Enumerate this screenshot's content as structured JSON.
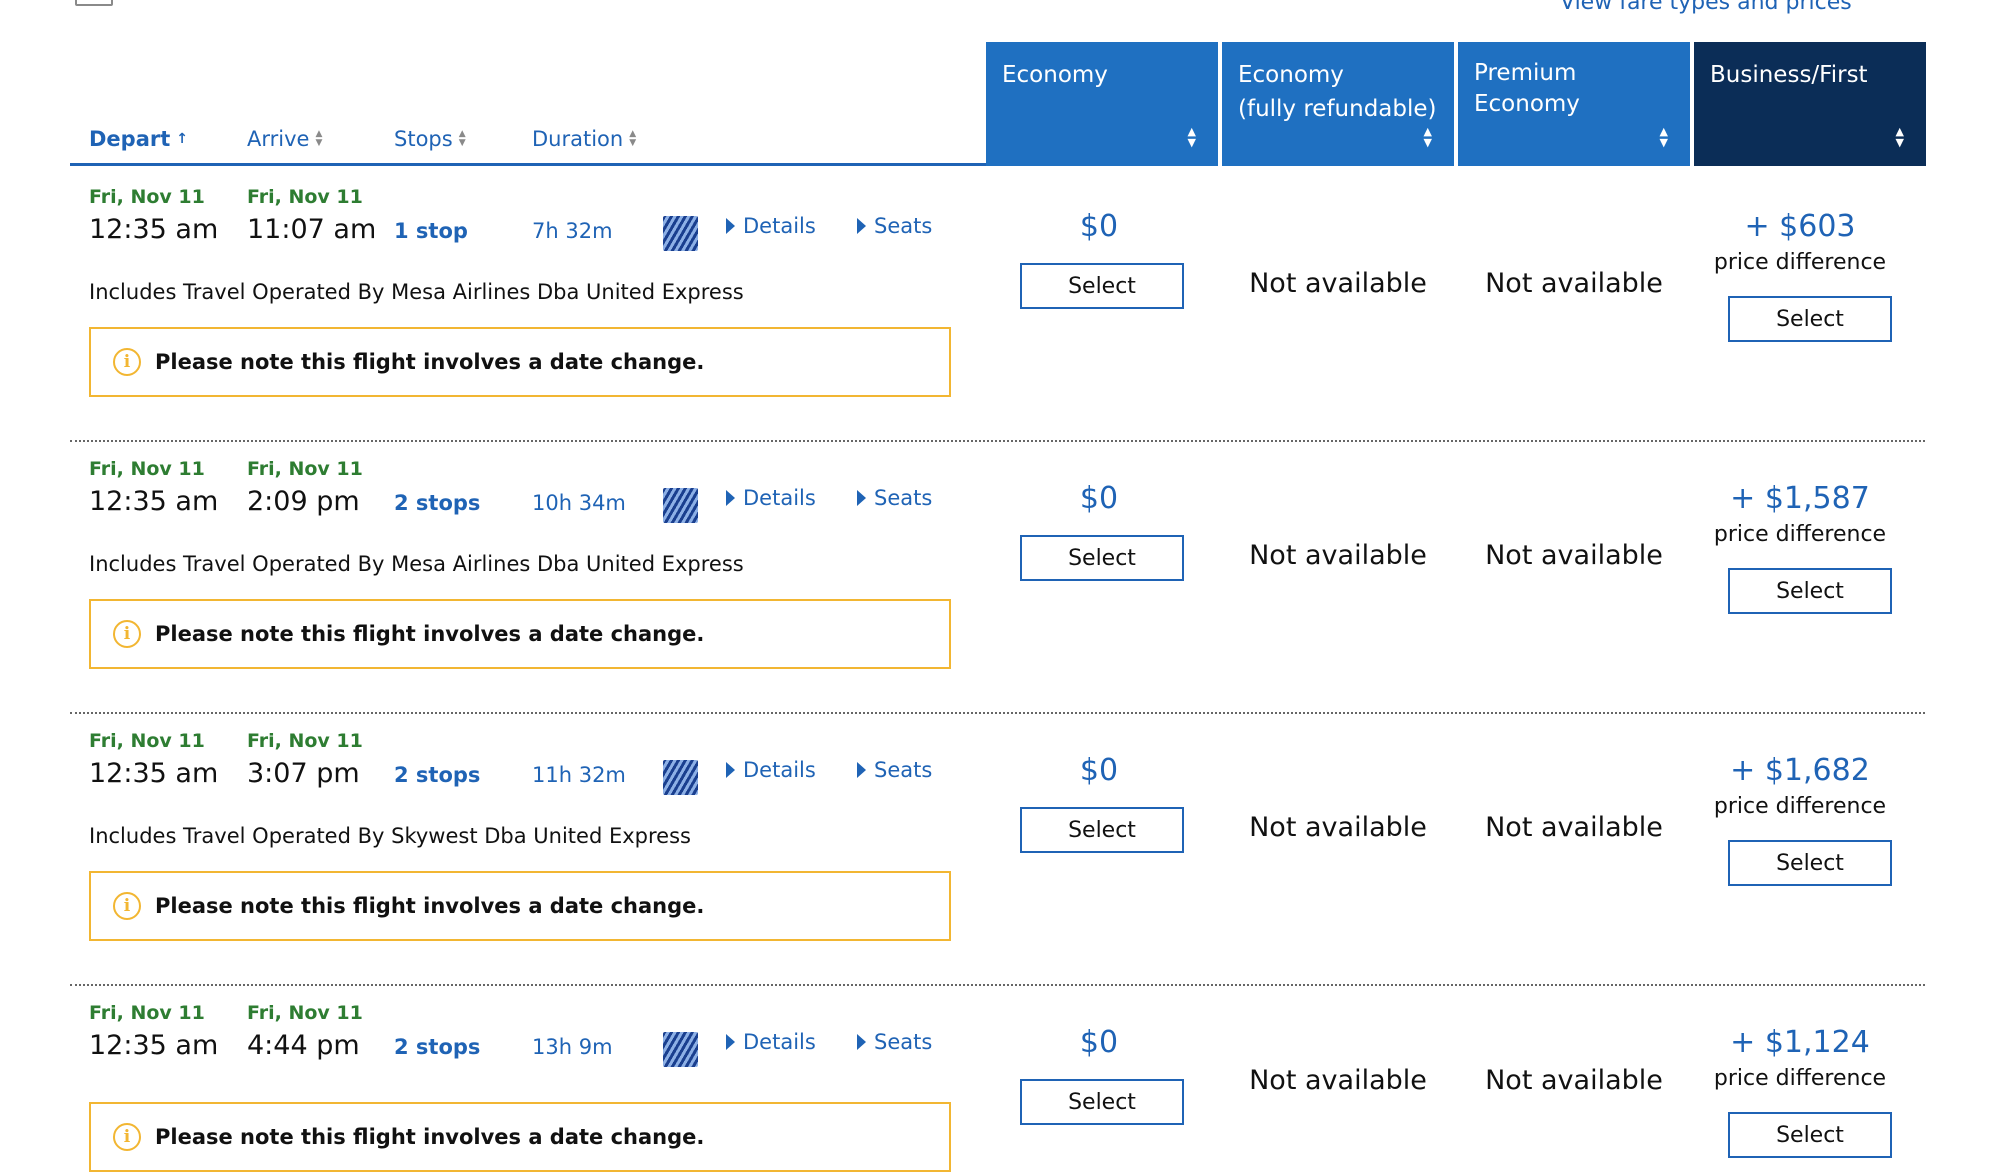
{
  "top": {
    "partial_link": "View fare types and prices"
  },
  "sort_bar": {
    "depart": "Depart",
    "arrive": "Arrive",
    "stops": "Stops",
    "duration": "Duration"
  },
  "fare_columns": [
    {
      "line1": "Economy",
      "line2": ""
    },
    {
      "line1": "Economy",
      "line2": "(fully refundable)"
    },
    {
      "line1": "Premium",
      "line2": "Economy"
    },
    {
      "line1": "Business/First",
      "line2": ""
    }
  ],
  "labels": {
    "details": "Details",
    "seats": "Seats",
    "select": "Select",
    "not_available": "Not available",
    "price_difference": "price difference",
    "date_change_notice": "Please note this flight involves a date change.",
    "info_symbol": "i"
  },
  "colors": {
    "accent_blue": "#1f70c1",
    "dark_navy": "#0b2d57",
    "date_green": "#2e7d32",
    "notice_border": "#f2b632"
  },
  "flights": [
    {
      "depart_date": "Fri, Nov 11",
      "arrive_date": "Fri, Nov 11",
      "depart_time": "12:35 am",
      "arrive_time": "11:07 am",
      "stops": "1 stop",
      "duration": "7h 32m",
      "operated_by": "Includes Travel Operated By Mesa Airlines Dba United Express",
      "economy_price": "$0",
      "business_price": "+ $603"
    },
    {
      "depart_date": "Fri, Nov 11",
      "arrive_date": "Fri, Nov 11",
      "depart_time": "12:35 am",
      "arrive_time": "2:09 pm",
      "stops": "2 stops",
      "duration": "10h 34m",
      "operated_by": "Includes Travel Operated By Mesa Airlines Dba United Express",
      "economy_price": "$0",
      "business_price": "+ $1,587"
    },
    {
      "depart_date": "Fri, Nov 11",
      "arrive_date": "Fri, Nov 11",
      "depart_time": "12:35 am",
      "arrive_time": "3:07 pm",
      "stops": "2 stops",
      "duration": "11h 32m",
      "operated_by": "Includes Travel Operated By Skywest Dba United Express",
      "economy_price": "$0",
      "business_price": "+ $1,682"
    },
    {
      "depart_date": "Fri, Nov 11",
      "arrive_date": "Fri, Nov 11",
      "depart_time": "12:35 am",
      "arrive_time": "4:44 pm",
      "stops": "2 stops",
      "duration": "13h 9m",
      "operated_by": "",
      "economy_price": "$0",
      "business_price": "+ $1,124"
    }
  ]
}
